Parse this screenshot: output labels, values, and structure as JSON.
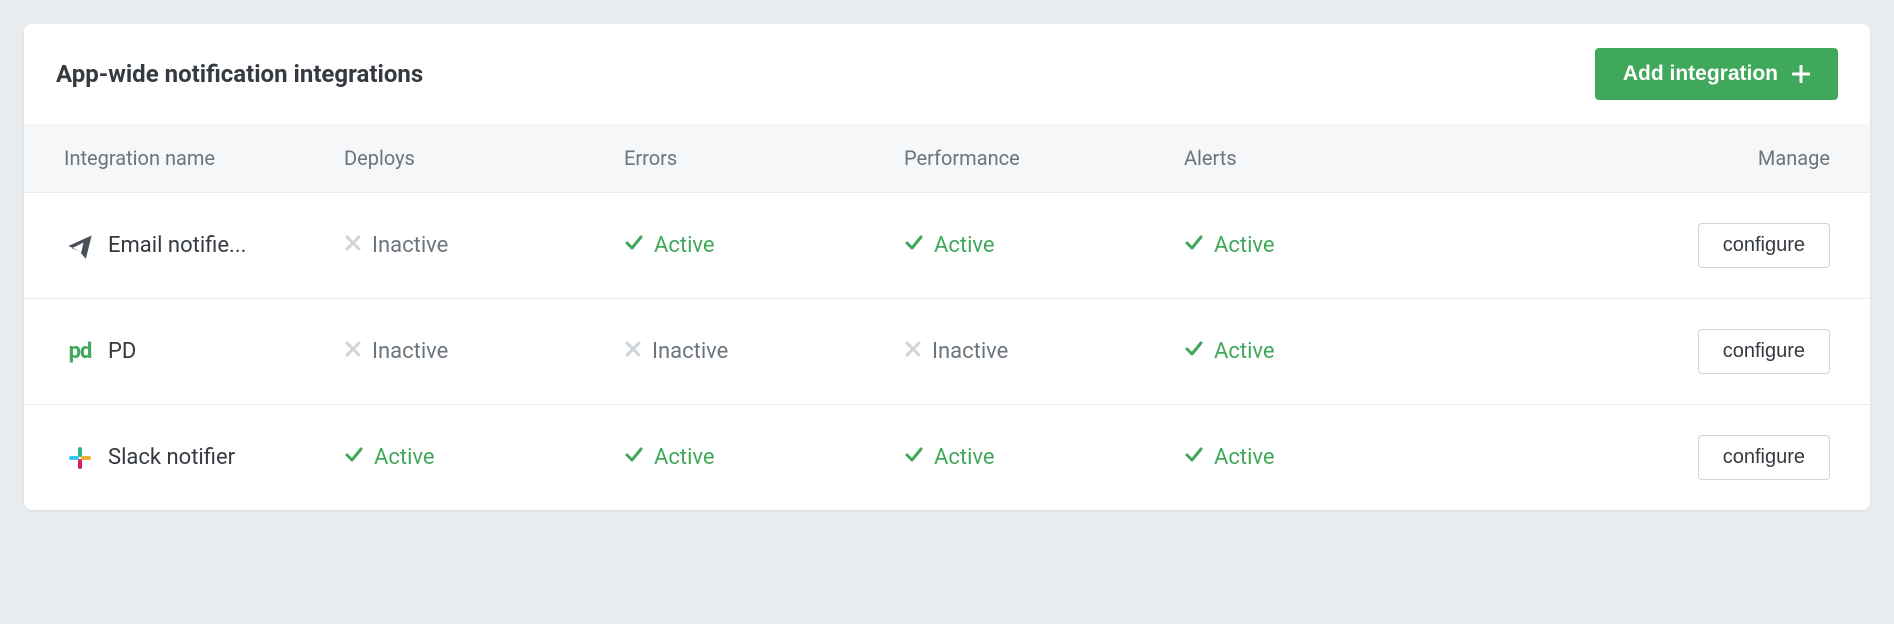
{
  "header": {
    "title": "App-wide notification integrations",
    "add_button_label": "Add integration"
  },
  "columns": {
    "name": "Integration name",
    "deploys": "Deploys",
    "errors": "Errors",
    "performance": "Performance",
    "alerts": "Alerts",
    "manage": "Manage"
  },
  "status_labels": {
    "active": "Active",
    "inactive": "Inactive"
  },
  "configure_label": "configure",
  "integrations": [
    {
      "name": "Email notifie...",
      "icon": "paper-plane",
      "deploys": "inactive",
      "errors": "active",
      "performance": "active",
      "alerts": "active"
    },
    {
      "name": "PD",
      "icon": "pd",
      "deploys": "inactive",
      "errors": "inactive",
      "performance": "inactive",
      "alerts": "active"
    },
    {
      "name": "Slack notifier",
      "icon": "slack",
      "deploys": "active",
      "errors": "active",
      "performance": "active",
      "alerts": "active"
    }
  ]
}
